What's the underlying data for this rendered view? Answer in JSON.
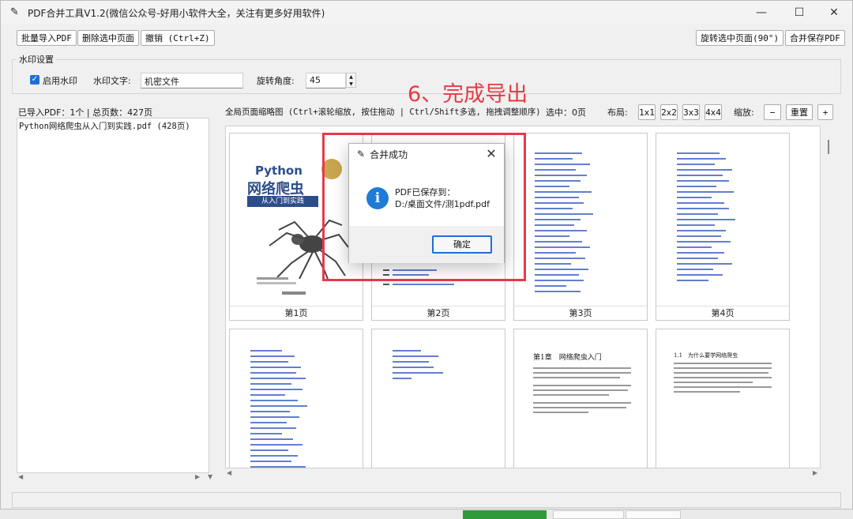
{
  "window": {
    "title": "PDF合并工具V1.2(微信公众号-好用小软件大全，关注有更多好用软件)",
    "minimize": "—",
    "maximize": "☐",
    "close": "✕"
  },
  "toolbar": {
    "import_label": "批量导入PDF",
    "delete_label": "删除选中页面",
    "undo_label": "撤销 (Ctrl+Z)",
    "rotate_label": "旋转选中页面(90°)",
    "merge_label": "合并保存PDF"
  },
  "watermark": {
    "group_label": "水印设置",
    "enable_label": "启用水印",
    "text_label": "水印文字:",
    "text_value": "机密文件",
    "angle_label": "旋转角度:",
    "angle_value": "45"
  },
  "status": {
    "imported": "已导入PDF：1个 | 总页数：427页",
    "thumb_hint": "全局页面缩略图 (Ctrl+滚轮缩放, 按住拖动 | Ctrl/Shift多选, 拖拽调整顺序)",
    "selected": "选中：0页",
    "layout_label": "布局:",
    "zoom_label": "缩放:"
  },
  "layout_buttons": [
    "1x1",
    "2x2",
    "3x3",
    "4x4"
  ],
  "zoom_buttons": {
    "minus": "−",
    "reset": "重置",
    "plus": "+"
  },
  "file_list": [
    "Python网络爬虫从入门到实践.pdf (428页)"
  ],
  "pages": [
    {
      "label": "第1页",
      "cover_title": "Python",
      "cover_subtitle": "网络爬虫",
      "cover_tag": "从入门到实践"
    },
    {
      "label": "第2页"
    },
    {
      "label": "第3页"
    },
    {
      "label": "第4页"
    },
    {
      "label": ""
    },
    {
      "label": ""
    },
    {
      "label": "",
      "heading": "第1章　网络爬虫入门"
    },
    {
      "label": "",
      "heading": "1.1　为什么要学网络爬虫"
    }
  ],
  "annotation": "6、完成导出",
  "dialog": {
    "title": "合并成功",
    "close": "✕",
    "message_line1": "PDF已保存到：",
    "message_line2": "D:/桌面文件/测1pdf.pdf",
    "ok_label": "确定",
    "icon_glyph": "i"
  },
  "colors": {
    "accent": "#1f6fd1",
    "annotation_red": "#e63b45",
    "toc_link": "#3b5fc4"
  }
}
